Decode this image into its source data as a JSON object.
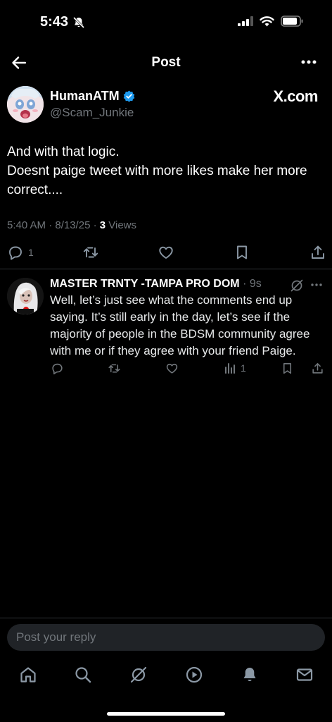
{
  "status_bar": {
    "time": "5:43"
  },
  "header": {
    "title": "Post"
  },
  "post": {
    "author_name": "HumanATM",
    "author_handle": "@Scam_Junkie",
    "source_badge": "X.com",
    "text_line1": "And with that logic.",
    "text_line2": "Doesnt paige tweet with more likes make her more correct....",
    "timestamp": "5:40 AM · 8/13/25 · ",
    "views_count": "3",
    "views_label": " Views",
    "reply_count": "1"
  },
  "reply": {
    "author_name": "MASTER TRNTY -TAMPA PRO DOM",
    "time": " · 9s",
    "text": "Well, let’s just see what the comments end up saying. It’s still early in the day, let’s see if the majority of people in the BDSM community agree with me or if they agree with your friend Paige.",
    "views_count": "1"
  },
  "composer": {
    "placeholder": "Post your reply"
  },
  "colors": {
    "background": "#000000",
    "secondary_text": "#71767b",
    "verified_blue": "#1d9bf0",
    "divider": "#2f3336"
  }
}
